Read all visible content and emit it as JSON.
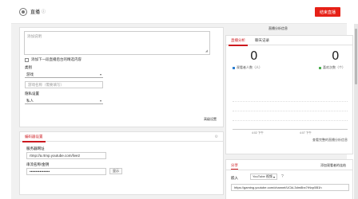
{
  "header": {
    "title": "直播",
    "end_button": "结束直播"
  },
  "details": {
    "description_placeholder": "添加说明",
    "checkbox_label": "添加下一段直播后台的精选内容",
    "category_label": "类别",
    "category_value": "游戏",
    "game_placeholder": "游戏名称（需要填写）",
    "privacy_label": "隐私设置",
    "privacy_value": "私人",
    "advanced_link": "高级设置"
  },
  "encoder": {
    "tab_label": "编码器设置",
    "server_label": "服务器网址",
    "server_value": "rtmp://a.rtmp.youtube.com/live2",
    "key_label": "串流名称/金钥",
    "key_masked": "••••••••••••••••",
    "reveal_button": "显示"
  },
  "analytics": {
    "top_link": "直播分析信息",
    "tabs": [
      "直播分析",
      "聊天记录"
    ],
    "viewers": 0,
    "viewers_caption": "观看者人数（人）",
    "likes": 0,
    "likes_caption": "喜欢次数（个）",
    "tick_left": "4:02 下午",
    "tick_right": "4:07 下午",
    "footer": "查看完整的直播分析信息"
  },
  "share": {
    "tab_label": "分享",
    "right_link": "添加观看者的连结",
    "embed_label": "嵌入",
    "embed_select": "YouTube 视频",
    "url": "https://gaming.youtube.com/channel/UCkL3dm8bx7rNvp5B1h"
  },
  "colors": {
    "accent": "#cc181e",
    "end_button": "#e62117",
    "viewer_dot": "#2d7fd0",
    "like_dot": "#4caf50"
  },
  "icons": [
    "status-icon",
    "info-icon",
    "settings-icon",
    "help-icon",
    "chevron-down-icon",
    "resize-icon"
  ]
}
